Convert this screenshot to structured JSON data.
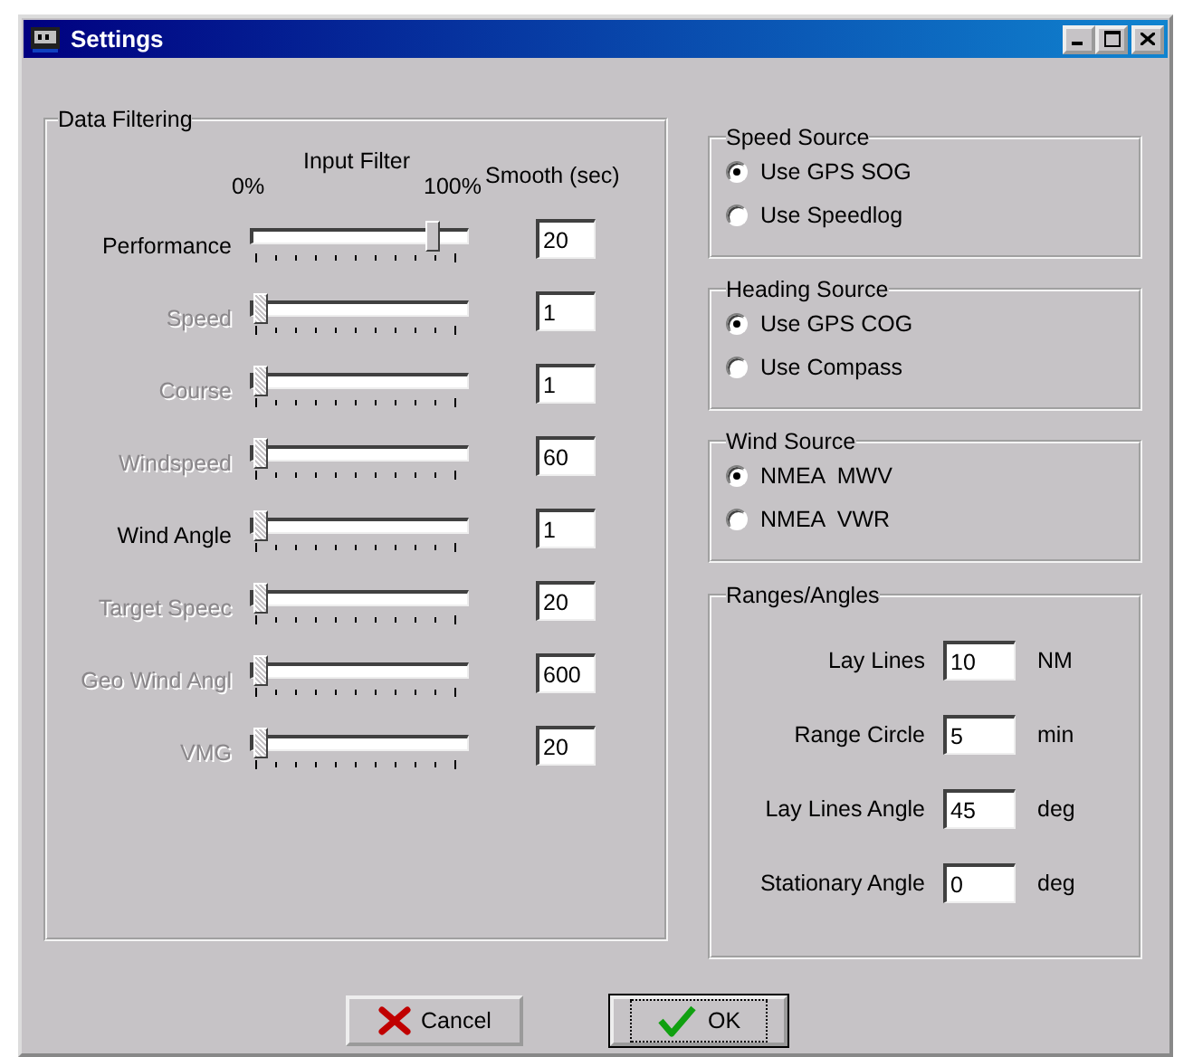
{
  "window": {
    "title": "Settings"
  },
  "data_filtering": {
    "title": "Data Filtering",
    "input_filter_label": "Input Filter",
    "min_label": "0%",
    "max_label": "100%",
    "smooth_label": "Smooth (sec)",
    "rows": [
      {
        "label": "Performance",
        "disabled": false,
        "level": 0.9,
        "smooth": "20"
      },
      {
        "label": "Speed",
        "disabled": true,
        "level": 0,
        "smooth": "1"
      },
      {
        "label": "Course",
        "disabled": true,
        "level": 0,
        "smooth": "1"
      },
      {
        "label": "Windspeed",
        "disabled": true,
        "level": 0,
        "smooth": "60"
      },
      {
        "label": "Wind Angle",
        "disabled": false,
        "level": 0,
        "smooth": "1"
      },
      {
        "label": "Target Speec",
        "disabled": true,
        "level": 0,
        "smooth": "20"
      },
      {
        "label": "Geo Wind Angl",
        "disabled": true,
        "level": 0,
        "smooth": "600"
      },
      {
        "label": "VMG",
        "disabled": true,
        "level": 0,
        "smooth": "20"
      }
    ]
  },
  "source_groups": [
    {
      "title": "Speed Source",
      "options": [
        {
          "label": "Use GPS SOG",
          "selected": true
        },
        {
          "label": "Use Speedlog",
          "selected": false
        }
      ]
    },
    {
      "title": "Heading Source",
      "options": [
        {
          "label": "Use GPS COG",
          "selected": true
        },
        {
          "label": "Use Compass",
          "selected": false
        }
      ]
    },
    {
      "title": "Wind Source",
      "options": [
        {
          "label": "NMEA  MWV",
          "selected": true
        },
        {
          "label": "NMEA  VWR",
          "selected": false
        }
      ]
    }
  ],
  "ranges": {
    "title": "Ranges/Angles",
    "fields": [
      {
        "label": "Lay Lines",
        "value": "10",
        "unit": "NM"
      },
      {
        "label": "Range Circle",
        "value": "5",
        "unit": "min"
      },
      {
        "label": "Lay Lines Angle",
        "value": "45",
        "unit": "deg"
      },
      {
        "label": "Stationary Angle",
        "value": "0",
        "unit": "deg"
      }
    ]
  },
  "buttons": [
    {
      "label": "Cancel",
      "kind": "cancel",
      "focused": false
    },
    {
      "label": "OK",
      "kind": "ok",
      "focused": true
    }
  ]
}
